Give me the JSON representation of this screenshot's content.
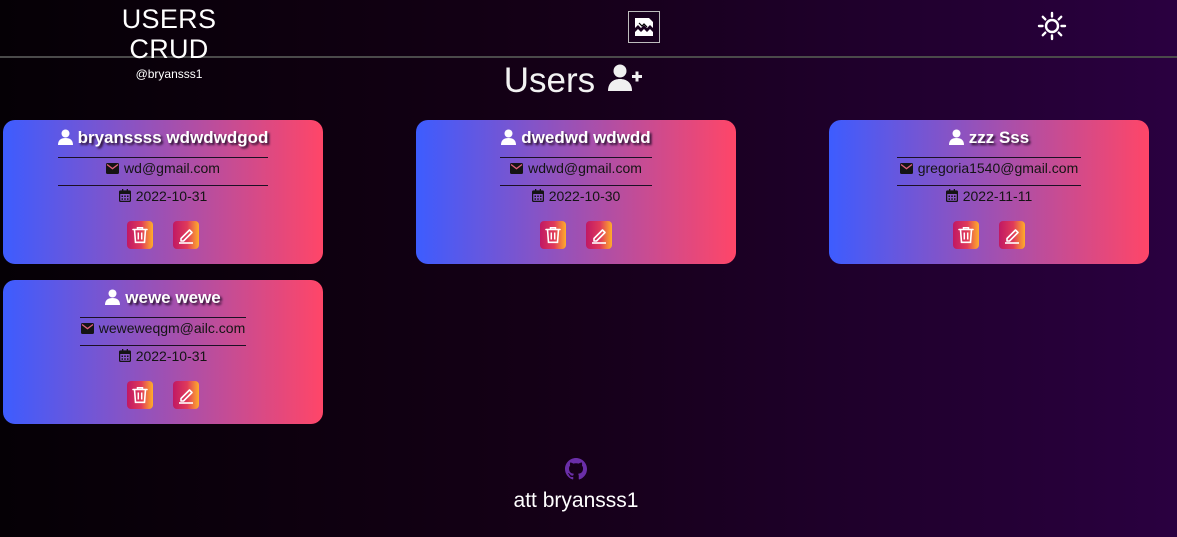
{
  "header": {
    "title": "USERS CRUD",
    "subtitle": "@bryansss1",
    "image_icon": "broken-image-icon",
    "theme_icon": "sun-icon"
  },
  "main": {
    "title": "Users",
    "add_icon": "user-plus-icon"
  },
  "users": [
    {
      "name": "bryanssss wdwdwdgod",
      "email": "wd@gmail.com",
      "date": "2022-10-31"
    },
    {
      "name": "dwedwd wdwdd",
      "email": "wdwd@gmail.com",
      "date": "2022-10-30"
    },
    {
      "name": "zzz Sss",
      "email": "gregoria1540@gmail.com",
      "date": "2022-11-11"
    },
    {
      "name": "wewe wewe",
      "email": "weweweqgm@ailc.com",
      "date": "2022-10-31"
    }
  ],
  "footer": {
    "icon": "github-icon",
    "text": "att bryansss1"
  },
  "colors": {
    "card_gradient_start": "#3d5cff",
    "card_gradient_end": "#ff4668",
    "button_gradient_start": "#c01864",
    "button_gradient_end": "#ffae2a",
    "github_icon": "#6a2ea8"
  }
}
